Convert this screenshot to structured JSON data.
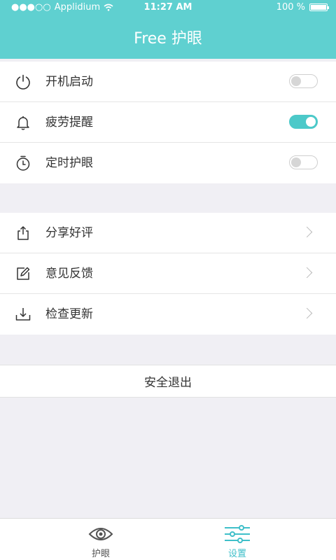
{
  "status_bar": {
    "carrier": "Applidium",
    "time": "11:27 AM",
    "battery": "100 %"
  },
  "header": {
    "title": "Free 护眼"
  },
  "toggles": [
    {
      "label": "开机启动",
      "icon": "power-icon",
      "on": false
    },
    {
      "label": "疲劳提醒",
      "icon": "bell-icon",
      "on": true
    },
    {
      "label": "定时护眼",
      "icon": "timer-icon",
      "on": false
    }
  ],
  "links": [
    {
      "label": "分享好评",
      "icon": "share-icon"
    },
    {
      "label": "意见反馈",
      "icon": "edit-icon"
    },
    {
      "label": "检查更新",
      "icon": "download-icon"
    }
  ],
  "logout_label": "安全退出",
  "tab_bar": [
    {
      "label": "护眼",
      "icon": "eye-icon",
      "active": false
    },
    {
      "label": "设置",
      "icon": "sliders-icon",
      "active": true
    }
  ],
  "colors": {
    "accent": "#5fd0d0",
    "toggle_on": "#4cc9c9",
    "tab_inactive": "#555555",
    "tab_active": "#3fbfc9",
    "background": "#f0eff4"
  }
}
